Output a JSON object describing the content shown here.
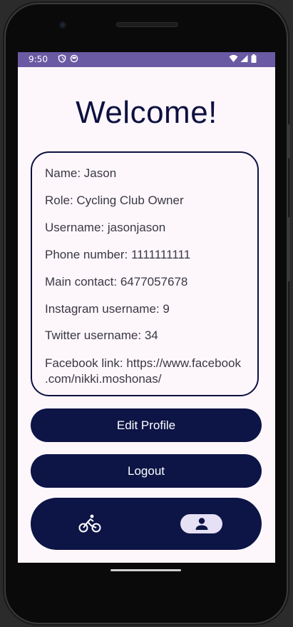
{
  "status_bar": {
    "time": "9:50",
    "icons": [
      "shield-icon",
      "face-icon",
      "wifi-icon",
      "signal-icon",
      "battery-icon"
    ]
  },
  "page": {
    "title": "Welcome!"
  },
  "profile": {
    "name": "Name: Jason",
    "role": "Role: Cycling Club Owner",
    "username": "Username: jasonjason",
    "phone": "Phone number: 1111111111",
    "main_contact": "Main contact: 6477057678",
    "instagram": "Instagram username: 9",
    "twitter": "Twitter username: 34",
    "facebook_line1": "Facebook link: https://www.facebook",
    "facebook_line2": ".com/nikki.moshonas/"
  },
  "actions": {
    "edit_profile": "Edit Profile",
    "logout": "Logout"
  },
  "bottom_nav": {
    "items": [
      {
        "icon": "bicycle-icon",
        "active": false
      },
      {
        "icon": "person-icon",
        "active": true
      }
    ]
  },
  "colors": {
    "primary": "#0d1446",
    "status_bar": "#6a5aa3",
    "background": "#fdf7fc",
    "active_indicator": "#e6e0f4"
  }
}
